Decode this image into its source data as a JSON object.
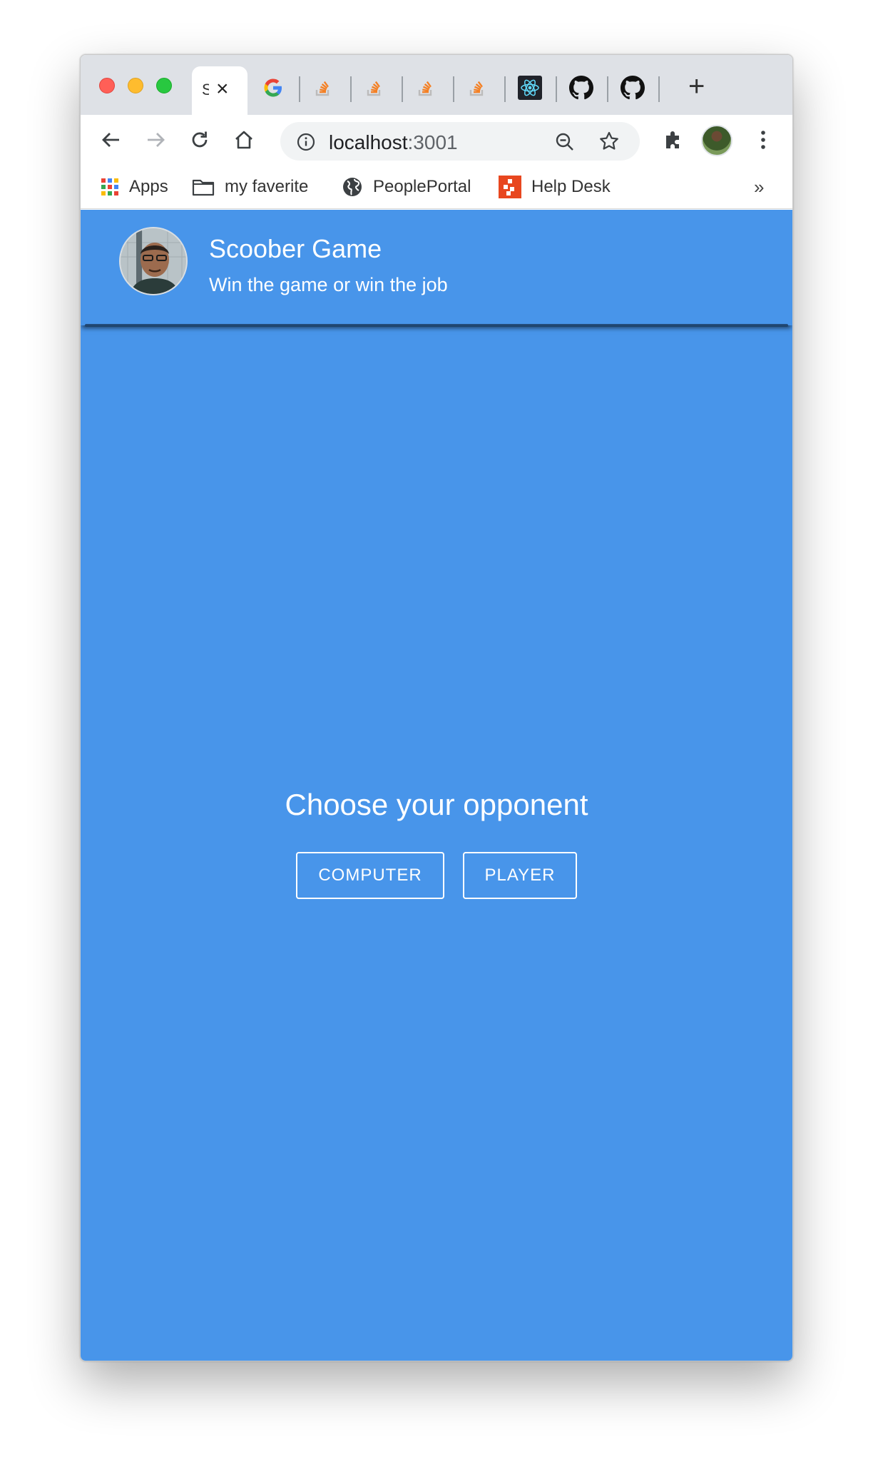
{
  "browser": {
    "active_tab_title": "S",
    "address": {
      "host": "localhost",
      "port": ":3001"
    },
    "bookmarks": [
      {
        "label": "Apps"
      },
      {
        "label": "my faverite"
      },
      {
        "label": "PeoplePortal"
      },
      {
        "label": "Help Desk"
      }
    ],
    "bookmarks_overflow": "»"
  },
  "app": {
    "title": "Scoober Game",
    "subtitle": "Win the game or win the job",
    "prompt": "Choose your opponent",
    "buttons": {
      "computer": "COMPUTER",
      "player": "PLAYER"
    }
  },
  "colors": {
    "page_background": "#4895ea",
    "text": "#ffffff"
  }
}
